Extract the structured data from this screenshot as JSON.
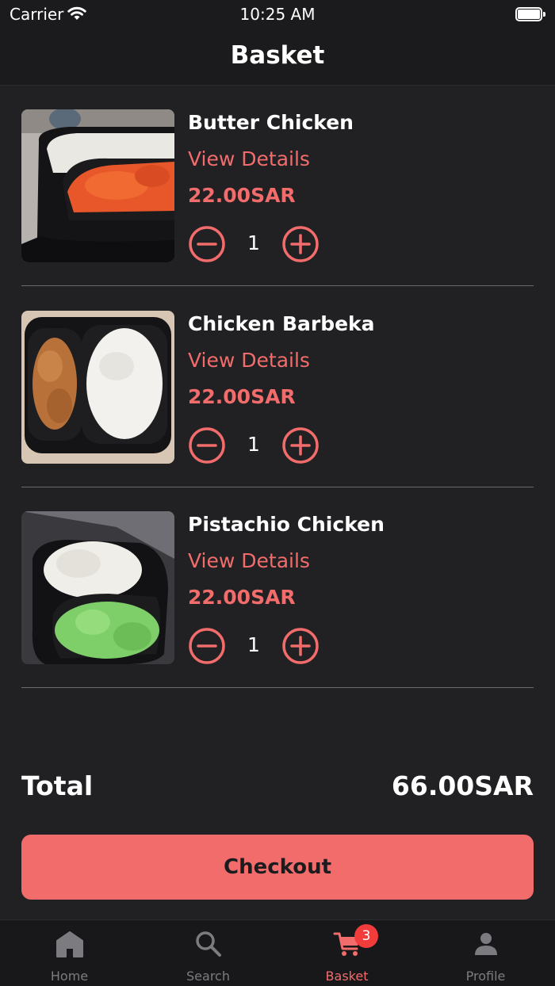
{
  "status_bar": {
    "carrier": "Carrier",
    "time": "10:25 AM",
    "wifi_icon": "wifi-icon",
    "battery_icon": "battery-icon"
  },
  "nav": {
    "title": "Basket"
  },
  "items": [
    {
      "name": "Butter Chicken",
      "details_label": "View Details",
      "price": "22.00SAR",
      "quantity": "1"
    },
    {
      "name": "Chicken Barbeka",
      "details_label": "View Details",
      "price": "22.00SAR",
      "quantity": "1"
    },
    {
      "name": "Pistachio Chicken",
      "details_label": "View Details",
      "price": "22.00SAR",
      "quantity": "1"
    }
  ],
  "summary": {
    "total_label": "Total",
    "total_value": "66.00SAR"
  },
  "checkout": {
    "label": "Checkout"
  },
  "tabs": [
    {
      "label": "Home",
      "icon": "home-icon"
    },
    {
      "label": "Search",
      "icon": "search-icon"
    },
    {
      "label": "Basket",
      "icon": "cart-icon",
      "badge": "3"
    },
    {
      "label": "Profile",
      "icon": "person-icon"
    }
  ],
  "colors": {
    "accent": "#f26c6c",
    "background": "#212124",
    "badge": "#f23b3b",
    "inactive_tab": "#7c7c80"
  }
}
